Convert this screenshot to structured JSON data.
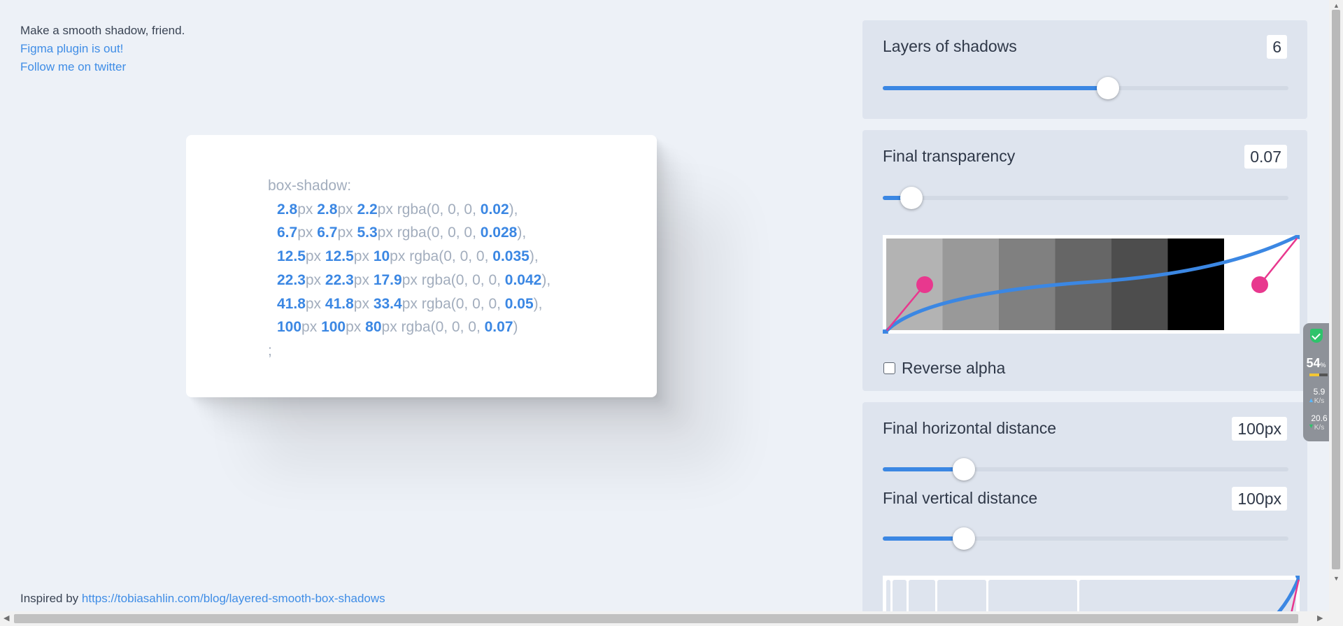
{
  "intro": {
    "tagline": "Make a smooth shadow, friend.",
    "figma_link": "Figma plugin is out!",
    "twitter_link": "Follow me on twitter"
  },
  "code": {
    "prop": "box-shadow:",
    "layers": [
      {
        "x": "2.8",
        "y": "2.8",
        "blur": "2.2",
        "alpha": "0.02",
        "sep": ","
      },
      {
        "x": "6.7",
        "y": "6.7",
        "blur": "5.3",
        "alpha": "0.028",
        "sep": ","
      },
      {
        "x": "12.5",
        "y": "12.5",
        "blur": "10",
        "alpha": "0.035",
        "sep": ","
      },
      {
        "x": "22.3",
        "y": "22.3",
        "blur": "17.9",
        "alpha": "0.042",
        "sep": ","
      },
      {
        "x": "41.8",
        "y": "41.8",
        "blur": "33.4",
        "alpha": "0.05",
        "sep": ","
      },
      {
        "x": "100",
        "y": "100",
        "blur": "80",
        "alpha": "0.07",
        "sep": ""
      }
    ],
    "px": "px",
    "rgba_prefix": "rgba(0, 0, 0, ",
    "rgba_suffix": ")",
    "end": ";"
  },
  "footer": {
    "prefix": "Inspired by",
    "link": "https://tobiasahlin.com/blog/layered-smooth-box-shadows"
  },
  "controls": {
    "layers": {
      "label": "Layers of shadows",
      "value": "6",
      "fraction": 0.556
    },
    "transparency": {
      "label": "Final transparency",
      "value": "0.07",
      "fraction": 0.07
    },
    "reverse_alpha": {
      "label": "Reverse alpha",
      "checked": false
    },
    "horizontal": {
      "label": "Final horizontal distance",
      "value": "100px",
      "fraction": 0.2
    },
    "vertical": {
      "label": "Final vertical distance",
      "value": "100px",
      "fraction": 0.2
    }
  },
  "alpha_swatches": [
    "#b3b3b3",
    "#999999",
    "#808080",
    "#666666",
    "#4d4d4d",
    "#000000"
  ],
  "colors": {
    "accent": "#3b87e3",
    "handle": "#e8388e",
    "panel": "#dee4ee",
    "background": "#edf1f7"
  },
  "net_widget": {
    "percent": "54",
    "percent_unit": "%",
    "up_rate": "5.9",
    "down_rate": "20.6",
    "unit": "K/s"
  }
}
